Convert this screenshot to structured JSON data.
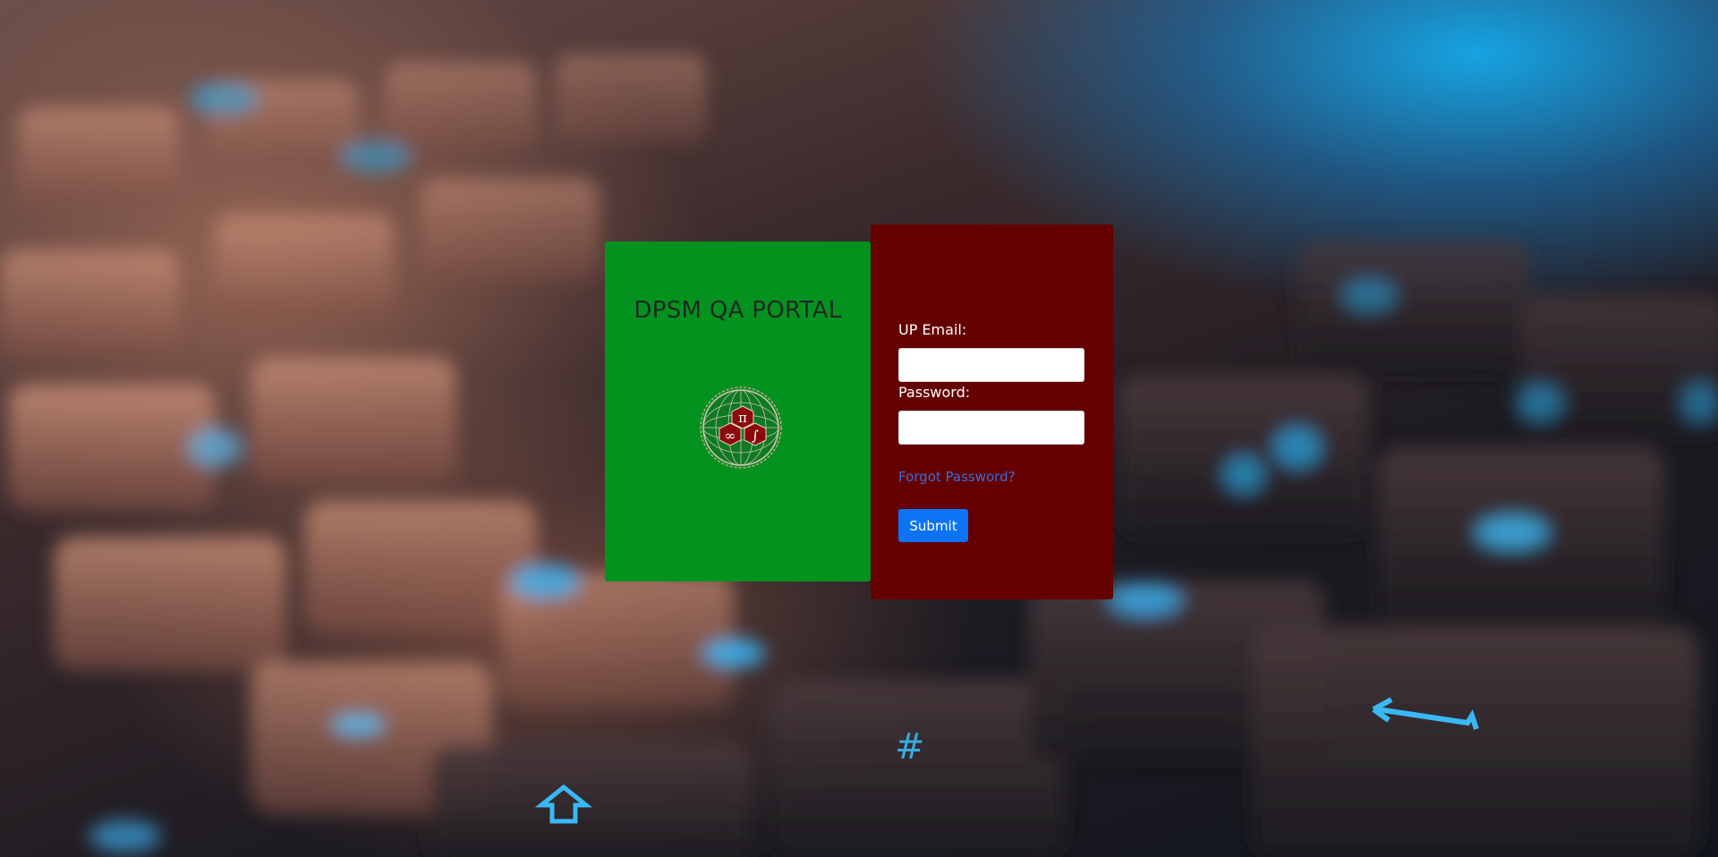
{
  "portal": {
    "title": "DPSM QA PORTAL",
    "logo_icons": [
      "pi-icon",
      "infinity-icon",
      "integral-icon",
      "globe-icon"
    ],
    "logo_glyphs": {
      "pi": "π",
      "infinity": "∞",
      "integral": "∫"
    }
  },
  "login": {
    "email_label": "UP Email:",
    "email_value": "",
    "password_label": "Password:",
    "password_value": "",
    "forgot_link": "Forgot Password?",
    "submit_label": "Submit"
  },
  "colors": {
    "green_panel": "#04921f",
    "red_panel": "#650000",
    "submit_button": "#0d73f5",
    "link": "#3a6bd8"
  },
  "background": {
    "description_icon": "keyboard-photo-background"
  }
}
